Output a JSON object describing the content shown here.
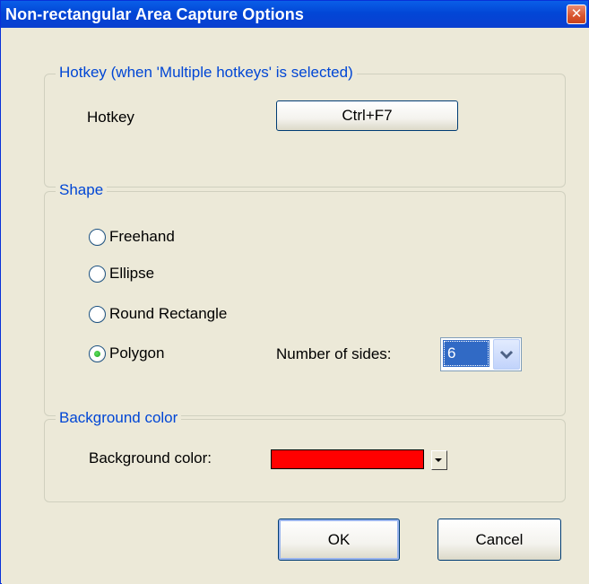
{
  "window": {
    "title": "Non-rectangular Area Capture Options",
    "close_icon": "close-icon"
  },
  "hotkey_group": {
    "label": "Hotkey (when 'Multiple hotkeys' is selected)",
    "hotkey_label": "Hotkey",
    "hotkey_value": "Ctrl+F7"
  },
  "shape_group": {
    "label": "Shape",
    "options": [
      {
        "label": "Freehand",
        "selected": false
      },
      {
        "label": "Ellipse",
        "selected": false
      },
      {
        "label": "Round Rectangle",
        "selected": false
      },
      {
        "label": "Polygon",
        "selected": true
      }
    ],
    "sides_label": "Number of sides:",
    "sides_value": "6"
  },
  "background_group": {
    "label": "Background color",
    "color_label": "Background color:",
    "color_value": "#ff0000"
  },
  "buttons": {
    "ok": "OK",
    "cancel": "Cancel"
  },
  "colors": {
    "title_bar": "#0a4fdc",
    "group_label": "#0046d5",
    "dialog_bg": "#ece9d8",
    "selection": "#316ac5"
  }
}
